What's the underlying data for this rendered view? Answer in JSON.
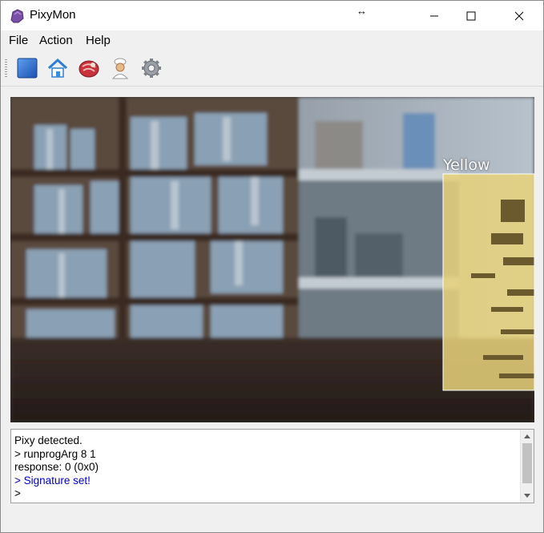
{
  "window": {
    "title": "PixyMon",
    "resize_hint": "↔"
  },
  "menu": {
    "items": [
      {
        "label": "File"
      },
      {
        "label": "Action"
      },
      {
        "label": "Help"
      }
    ]
  },
  "toolbar": {
    "tools": [
      {
        "icon": "run-stop-icon"
      },
      {
        "icon": "home-icon"
      },
      {
        "icon": "raw-video-icon"
      },
      {
        "icon": "cooked-video-icon"
      },
      {
        "icon": "gear-icon"
      }
    ]
  },
  "video": {
    "blob_label": "Yellow",
    "blob_color": "#e8d27a"
  },
  "console": {
    "lines": [
      {
        "text": "Pixy detected."
      },
      {
        "text": "> runprogArg 8 1"
      },
      {
        "text": "response: 0 (0x0)"
      },
      {
        "text": "> Signature set!"
      },
      {
        "text": ">"
      }
    ]
  },
  "colors": {
    "highlight_text": "#0000c8",
    "app_icon": "#7b4fa8"
  }
}
